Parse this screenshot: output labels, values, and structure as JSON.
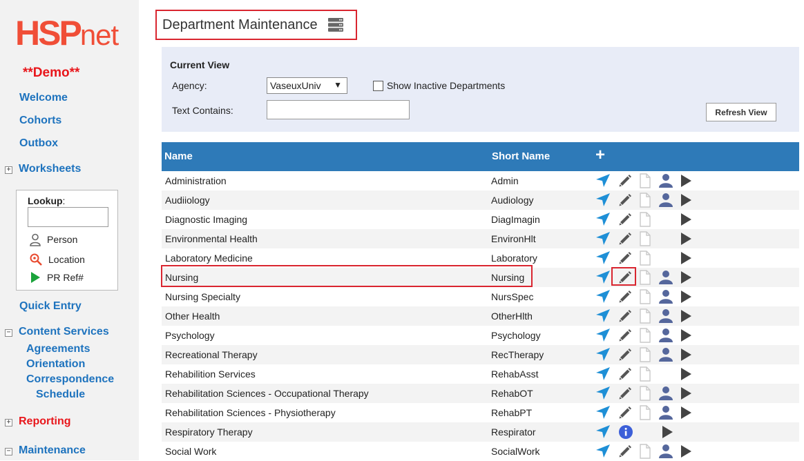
{
  "sidebar": {
    "logo_hsp": "HSP",
    "logo_net": "net",
    "demo": "**Demo**",
    "links": {
      "welcome": "Welcome",
      "cohorts": "Cohorts",
      "outbox": "Outbox",
      "worksheets": "Worksheets",
      "quick_entry": "Quick Entry",
      "content_services": "Content Services",
      "agreements": "Agreements",
      "orientation": "Orientation",
      "correspondence": "Correspondence",
      "schedule": "Schedule",
      "reporting": "Reporting",
      "maintenance": "Maintenance"
    },
    "tree_toggles": {
      "worksheets": "+",
      "content_services": "−",
      "reporting": "+",
      "maintenance": "−"
    },
    "lookup": {
      "title": "Lookup",
      "suffix": ":",
      "value": "",
      "person": "Person",
      "location": "Location",
      "pr_ref": "PR Ref#"
    }
  },
  "header": {
    "title": "Department Maintenance",
    "icon": "server-icon"
  },
  "filter": {
    "current_view": "Current View",
    "agency_label": "Agency:",
    "agency_value": "VaseuxUniv",
    "show_inactive_label": "Show Inactive Departments",
    "show_inactive_checked": false,
    "text_contains_label": "Text Contains:",
    "text_contains_value": "",
    "refresh_button": "Refresh View"
  },
  "table": {
    "columns": {
      "name": "Name",
      "short_name": "Short Name",
      "add": "+"
    },
    "rows": [
      {
        "name": "Administration",
        "short": "Admin",
        "person": true,
        "doc": true
      },
      {
        "name": "Audiiology",
        "short": "Audiology",
        "person": true,
        "doc": true
      },
      {
        "name": "Diagnostic Imaging",
        "short": "DiagImagin",
        "person": false,
        "doc": true
      },
      {
        "name": "Environmental Health",
        "short": "EnvironHlt",
        "person": false,
        "doc": true
      },
      {
        "name": "Laboratory Medicine",
        "short": "Laboratory",
        "person": false,
        "doc": true
      },
      {
        "name": "Nursing",
        "short": "Nursing",
        "person": true,
        "doc": true,
        "highlighted": true
      },
      {
        "name": "Nursing Specialty",
        "short": "NursSpec",
        "person": true,
        "doc": true
      },
      {
        "name": "Other Health",
        "short": "OtherHlth",
        "person": true,
        "doc": true
      },
      {
        "name": "Psychology",
        "short": "Psychology",
        "person": true,
        "doc": true
      },
      {
        "name": "Recreational Therapy",
        "short": "RecTherapy",
        "person": true,
        "doc": true
      },
      {
        "name": "Rehabilition Services",
        "short": "RehabAsst",
        "person": false,
        "doc": true
      },
      {
        "name": "Rehabilitation Sciences - Occupational Therapy",
        "short": "RehabOT",
        "person": true,
        "doc": true
      },
      {
        "name": "Rehabilitation Sciences - Physiotherapy",
        "short": "RehabPT",
        "person": true,
        "doc": true
      },
      {
        "name": "Respiratory Therapy",
        "short": "Respirator",
        "person": false,
        "doc": false,
        "info": true
      },
      {
        "name": "Social Work",
        "short": "SocialWork",
        "person": true,
        "doc": true
      }
    ]
  },
  "colors": {
    "brand": "#f04e37",
    "link": "#1e73be",
    "header_bg": "#2e7ab8",
    "panel_bg": "#e8ecf7",
    "highlight": "#d9252f",
    "icon_blue": "#1e8fd6",
    "person_icon": "#55679c"
  }
}
